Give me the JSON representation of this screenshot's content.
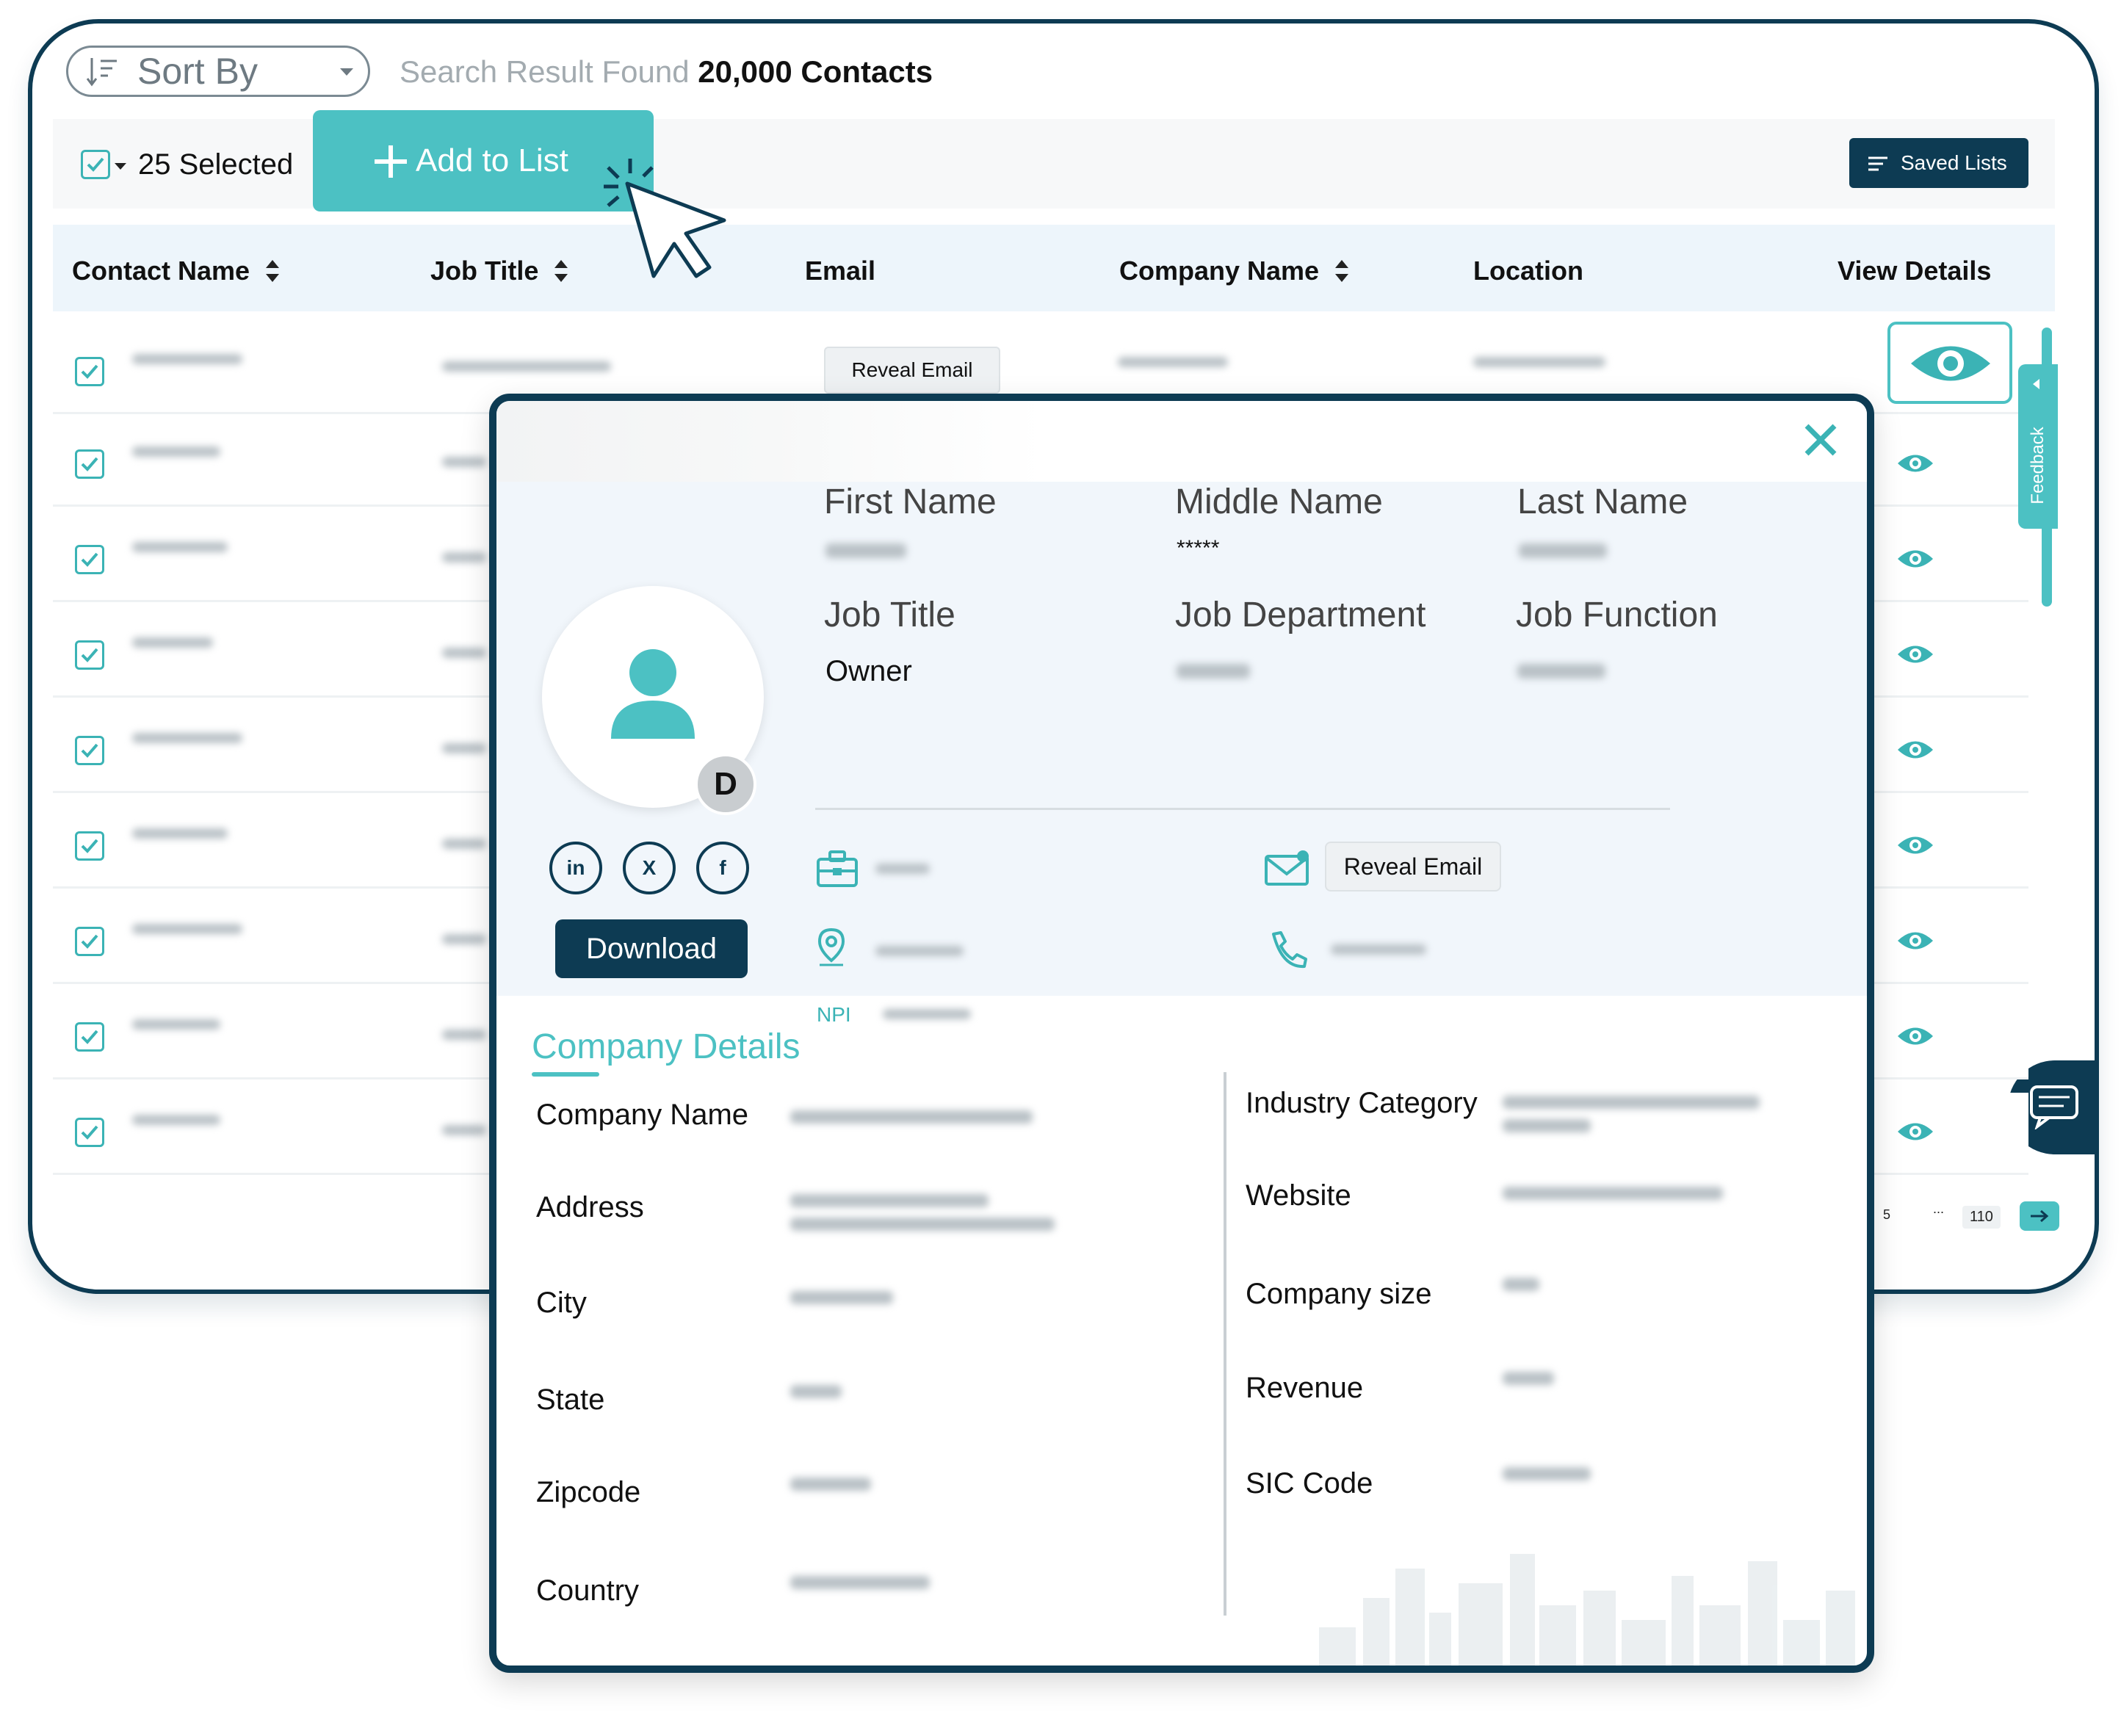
{
  "header": {
    "sort_label": "Sort By",
    "result_prefix": "Search Result Found",
    "result_count": "20,000 Contacts"
  },
  "toolbar": {
    "selected_label": "25 Selected",
    "add_to_list_label": "Add to List",
    "saved_lists_label": "Saved Lists"
  },
  "table": {
    "columns": [
      "Contact Name",
      "Job Title",
      "Email",
      "Company Name",
      "Location",
      "View Details"
    ],
    "first_row_reveal_email": "Reveal Email",
    "row_count_visible": 9
  },
  "side": {
    "feedback_label": "Feedback"
  },
  "pagination": {
    "page_5": "5",
    "ellipsis": "...",
    "last_page": "110"
  },
  "modal": {
    "avatar_initial": "D",
    "social": [
      "in",
      "X",
      "f"
    ],
    "download_label": "Download",
    "fields": {
      "first_name": "First Name",
      "middle_name": "Middle Name",
      "middle_name_value": "*****",
      "last_name": "Last Name",
      "job_title": "Job Title",
      "job_title_value": "Owner",
      "job_department": "Job Department",
      "job_function": "Job Function"
    },
    "reveal_email_label": "Reveal Email",
    "npi_label": "NPI",
    "company": {
      "title": "Company Details",
      "left_labels": [
        "Company Name",
        "Address",
        "City",
        "State",
        "Zipcode",
        "Country"
      ],
      "right_labels": [
        "Industry Category",
        "Website",
        "Company size",
        "Revenue",
        "SIC Code"
      ]
    }
  },
  "colors": {
    "navy": "#0d3b53",
    "teal": "#4cc1c3",
    "header_bg": "#edf5fb",
    "profile_bg": "#f1f6fb"
  }
}
